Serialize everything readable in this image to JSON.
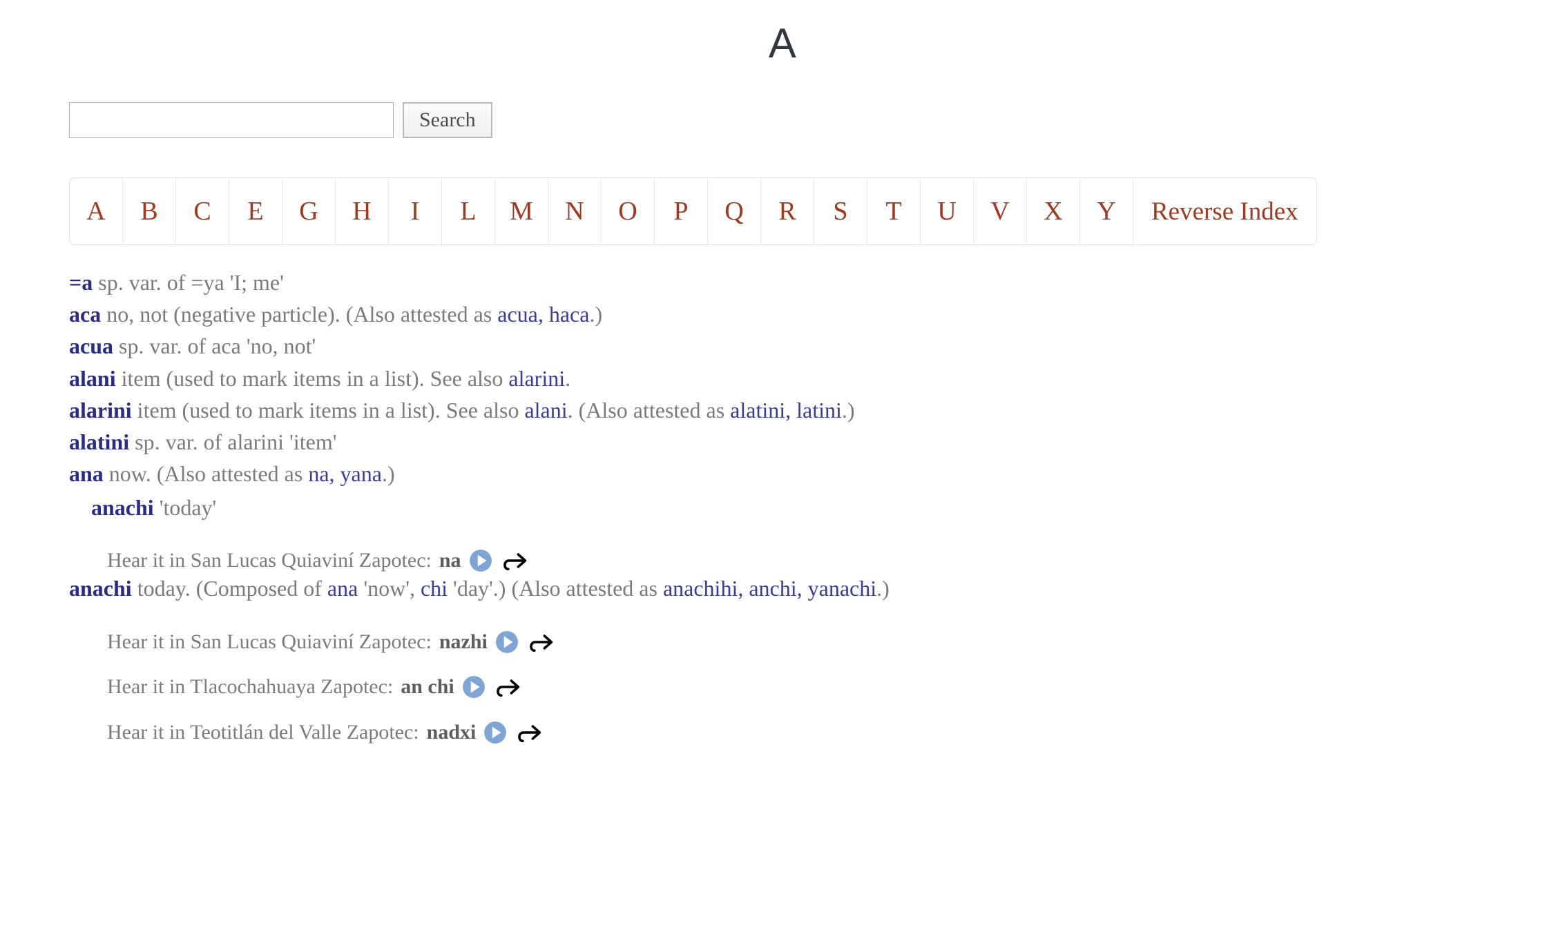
{
  "page": {
    "title": "A"
  },
  "search": {
    "value": "",
    "placeholder": "",
    "button_label": "Search"
  },
  "nav": {
    "letters": [
      "A",
      "B",
      "C",
      "E",
      "G",
      "H",
      "I",
      "L",
      "M",
      "N",
      "O",
      "P",
      "Q",
      "R",
      "S",
      "T",
      "U",
      "V",
      "X",
      "Y"
    ],
    "reverse_index_label": "Reverse Index"
  },
  "colors": {
    "headword": "#2a2a8c",
    "crossref": "#3b3b9e",
    "gloss": "#7b7b7b",
    "nav_letter": "#a2381f",
    "play_button": "#7fa5d4",
    "title": "#32363f"
  },
  "icons": {
    "play": "play-icon",
    "share": "share-icon"
  },
  "entries": [
    {
      "headword": "=a",
      "sp_var_label": "sp. var. of",
      "target": "=ya",
      "target_gloss": "'I; me'"
    },
    {
      "headword": "aca",
      "definition": "no, not (negative particle).",
      "attested_label": "(Also attested as",
      "attested": "acua, haca",
      "attested_close": ".)"
    },
    {
      "headword": "acua",
      "sp_var_label": "sp. var. of",
      "target": "aca",
      "target_gloss": "'no, not'"
    },
    {
      "headword": "alani",
      "definition": "item (used to mark items in a list).",
      "see_also_label": "See also",
      "see_also": "alarini",
      "see_also_close": "."
    },
    {
      "headword": "alarini",
      "definition": "item (used to mark items in a list).",
      "see_also_label": "See also",
      "see_also": "alani",
      "see_also_close": ".",
      "attested_label": "(Also attested as",
      "attested": "alatini, latini",
      "attested_close": ".)"
    },
    {
      "headword": "alatini",
      "sp_var_label": "sp. var. of",
      "target": "alarini",
      "target_gloss": "'item'"
    },
    {
      "headword": "ana",
      "definition": "now.",
      "attested_label": "(Also attested as",
      "attested": "na, yana",
      "attested_close": ".)",
      "subentry": {
        "headword": "anachi",
        "gloss": "'today'"
      },
      "audio": [
        {
          "label": "Hear it in San Lucas Quiaviní Zapotec:",
          "word": "na"
        }
      ]
    },
    {
      "headword": "anachi",
      "definition": "today. (Composed of",
      "composed": [
        {
          "word": "ana",
          "gloss": "'now',"
        },
        {
          "word": "chi",
          "gloss": "'day'.)"
        }
      ],
      "attested_label": "(Also attested as",
      "attested": "anachihi, anchi, yanachi",
      "attested_close": ".)",
      "audio": [
        {
          "label": "Hear it in San Lucas Quiaviní Zapotec:",
          "word": "nazhi"
        },
        {
          "label": "Hear it in Tlacochahuaya Zapotec:",
          "word": "an chi"
        },
        {
          "label": "Hear it in Teotitlán del Valle Zapotec:",
          "word": "nadxi"
        }
      ]
    }
  ]
}
